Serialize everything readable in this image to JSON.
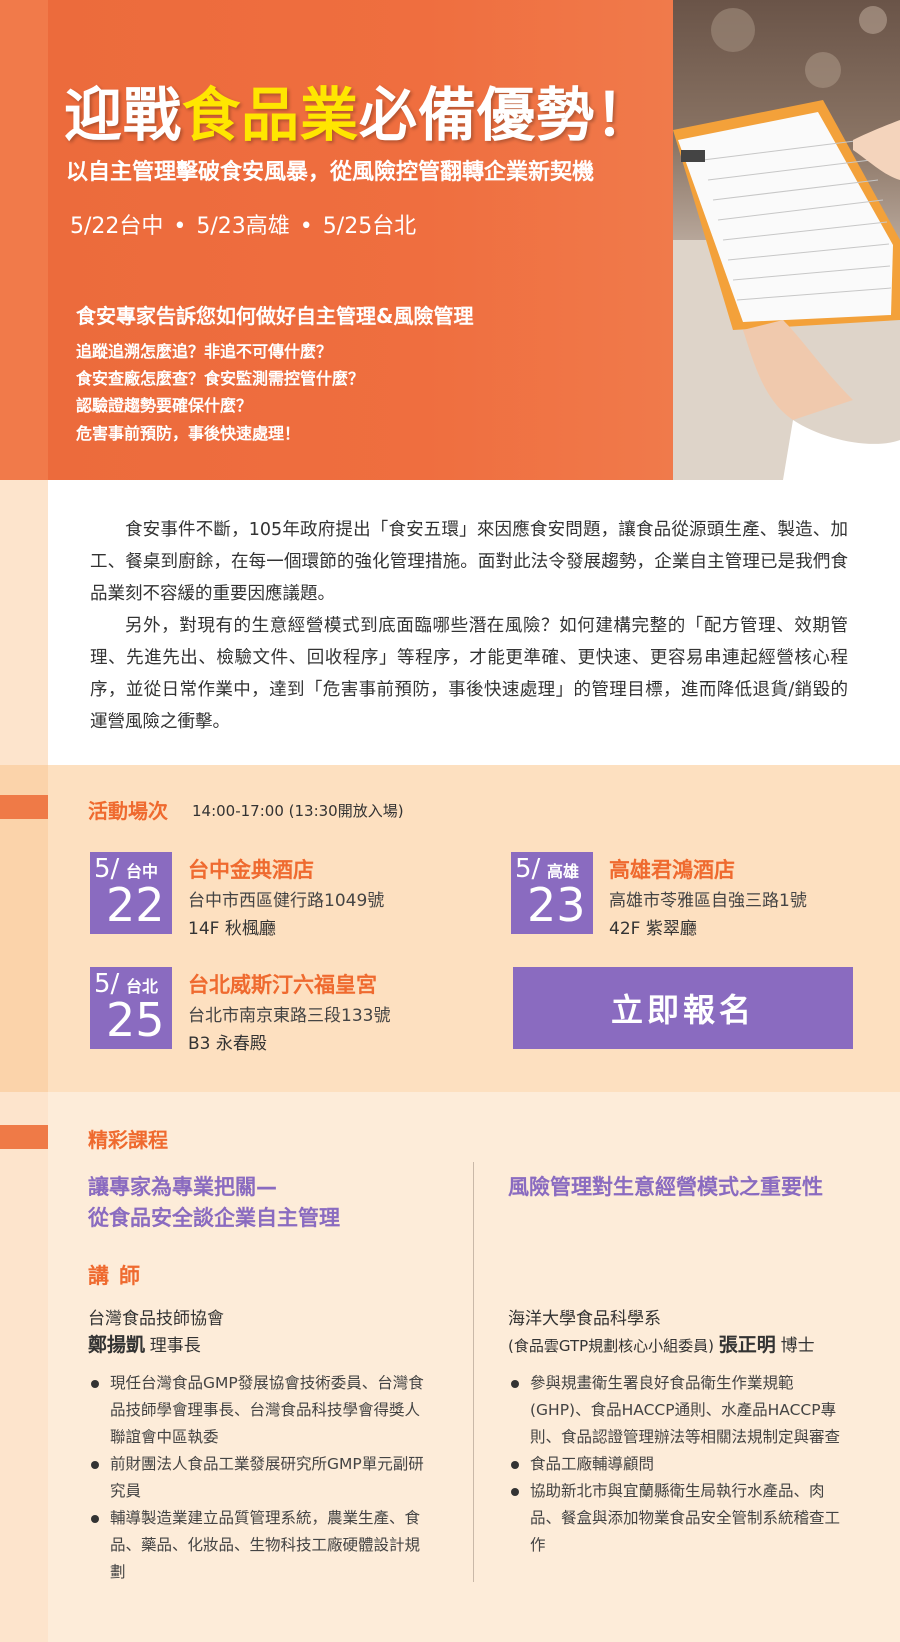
{
  "hero": {
    "title_prefix": "迎戰",
    "title_highlight": "食品業",
    "title_suffix": "必備優勢！",
    "subtitle": "以自主管理擊破食安風暴，從風險控管翻轉企業新契機",
    "dates": [
      "5/22台中",
      "5/23高雄",
      "5/25台北"
    ],
    "date_separator": "•",
    "expert_heading": "食安專家告訴您如何做好自主管理&風險管理",
    "questions": [
      "追蹤追溯怎麼追？非追不可傳什麼？",
      "食安查廠怎麼查？食安監測需控管什麼？",
      "認驗證趨勢要確保什麼？",
      "危害事前預防，事後快速處理！"
    ]
  },
  "intro": {
    "paragraphs": [
      "食安事件不斷，105年政府提出「食安五環」來因應食安問題，讓食品從源頭生產、製造、加工、餐桌到廚餘，在每一個環節的強化管理措施。面對此法令發展趨勢，企業自主管理已是我們食品業刻不容緩的重要因應議題。",
      "另外，對現有的生意經營模式到底面臨哪些潛在風險？如何建構完整的「配方管理、效期管理、先進先出、檢驗文件、回收程序」等程序，才能更準確、更快速、更容易串連起經營核心程序，並從日常作業中，達到「危害事前預防，事後快速處理」的管理目標，進而降低退貨/銷毀的運營風險之衝擊。"
    ]
  },
  "sessions": {
    "title": "活動場次",
    "time": "14:00-17:00 (13:30開放入場)",
    "venues": [
      {
        "month": "5/",
        "city": "台中",
        "day": "22",
        "name": "台中金典酒店",
        "address": "台中市西區健行路1049號",
        "room": "14F 秋楓廳"
      },
      {
        "month": "5/",
        "city": "高雄",
        "day": "23",
        "name": "高雄君鴻酒店",
        "address": "高雄市苓雅區自強三路1號",
        "room": "42F 紫翠廳"
      },
      {
        "month": "5/",
        "city": "台北",
        "day": "25",
        "name": "台北威斯汀六福皇宮",
        "address": "台北市南京東路三段133號",
        "room": "B3 永春殿"
      }
    ],
    "register_label": "立即報名"
  },
  "courses": {
    "title": "精彩課程",
    "left": {
      "title_line1": "讓專家為專業把關—",
      "title_line2": "從食品安全談企業自主管理",
      "instructor_label": "講師",
      "org": "台灣食品技師協會",
      "name": "鄭揚凱",
      "role": "理事長",
      "bullets": [
        "現任台灣食品GMP發展協會技術委員、台灣食品技師學會理事長、台灣食品科技學會得獎人聯誼會中區執委",
        "前財團法人食品工業發展研究所GMP單元副研究員",
        "輔導製造業建立品質管理系統，農業生產、食品、藥品、化妝品、生物科技工廠硬體設計規劃"
      ]
    },
    "right": {
      "title": "風險管理對生意經營模式之重要性",
      "org": "海洋大學食品科學系",
      "committee": "(食品雲GTP規劃核心小組委員)",
      "name": "張正明",
      "role": "博士",
      "bullets": [
        "參與規畫衛生署良好食品衛生作業規範(GHP)、食品HACCP通則、水產品HACCP專則、食品認證管理辦法等相關法規制定與審查",
        "食品工廠輔導顧問",
        "協助新北市與宜蘭縣衛生局執行水產品、肉品、餐盒與添加物業食品安全管制系統稽查工作"
      ]
    }
  },
  "colors": {
    "hero_orange": "#ec6b3c",
    "title_yellow": "#ffe600",
    "accent_orange": "#ef6a2f",
    "purple": "#8a6bc0",
    "peach": "#fde0c0"
  }
}
